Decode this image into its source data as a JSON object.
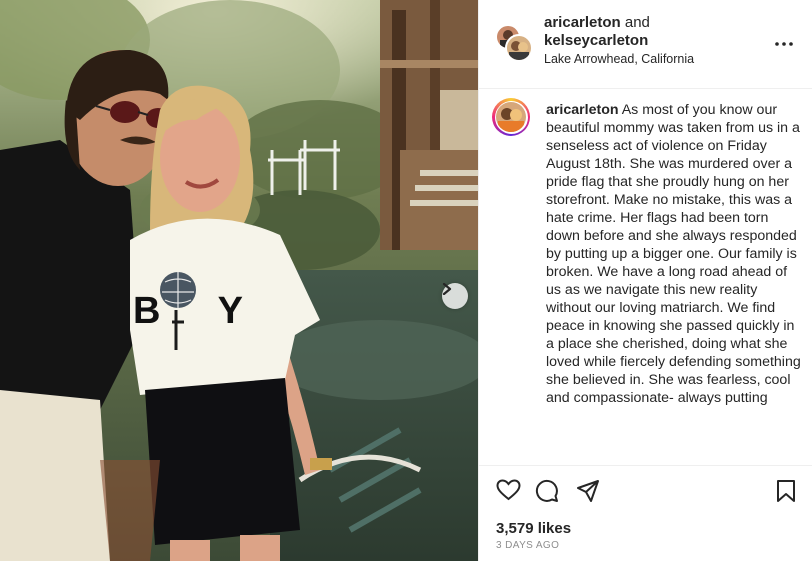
{
  "header": {
    "user1": "aricarleton",
    "connector": "and",
    "user2": "kelseycarleton",
    "location": "Lake Arrowhead, California",
    "more_icon": "more-horizontal-icon"
  },
  "caption": {
    "username": "aricarleton",
    "text": "As most of you know our beautiful mommy was taken from us in a senseless act of violence on Friday August 18th. She was murdered over a pride flag that she proudly hung on her storefront. Make no mistake, this was a hate crime. Her flags had been torn down before and she always responded by putting up a bigger one. Our family is broken. We have a long road ahead of us as we navigate this new reality without our loving matriarch. We find peace in knowing she passed quickly in a place she cherished, doing what she loved while fiercely defending something she believed in. She was fearless, cool and compassionate- always putting"
  },
  "photo": {
    "shirt_text": "B  Y"
  },
  "actions": {
    "like_icon": "heart-icon",
    "comment_icon": "comment-icon",
    "share_icon": "send-icon",
    "save_icon": "bookmark-icon"
  },
  "stats": {
    "likes": "3,579 likes",
    "posted": "3 DAYS AGO"
  },
  "colors": {
    "accent_text": "#262626",
    "muted": "#8e8e8e",
    "divider": "#efefef"
  }
}
